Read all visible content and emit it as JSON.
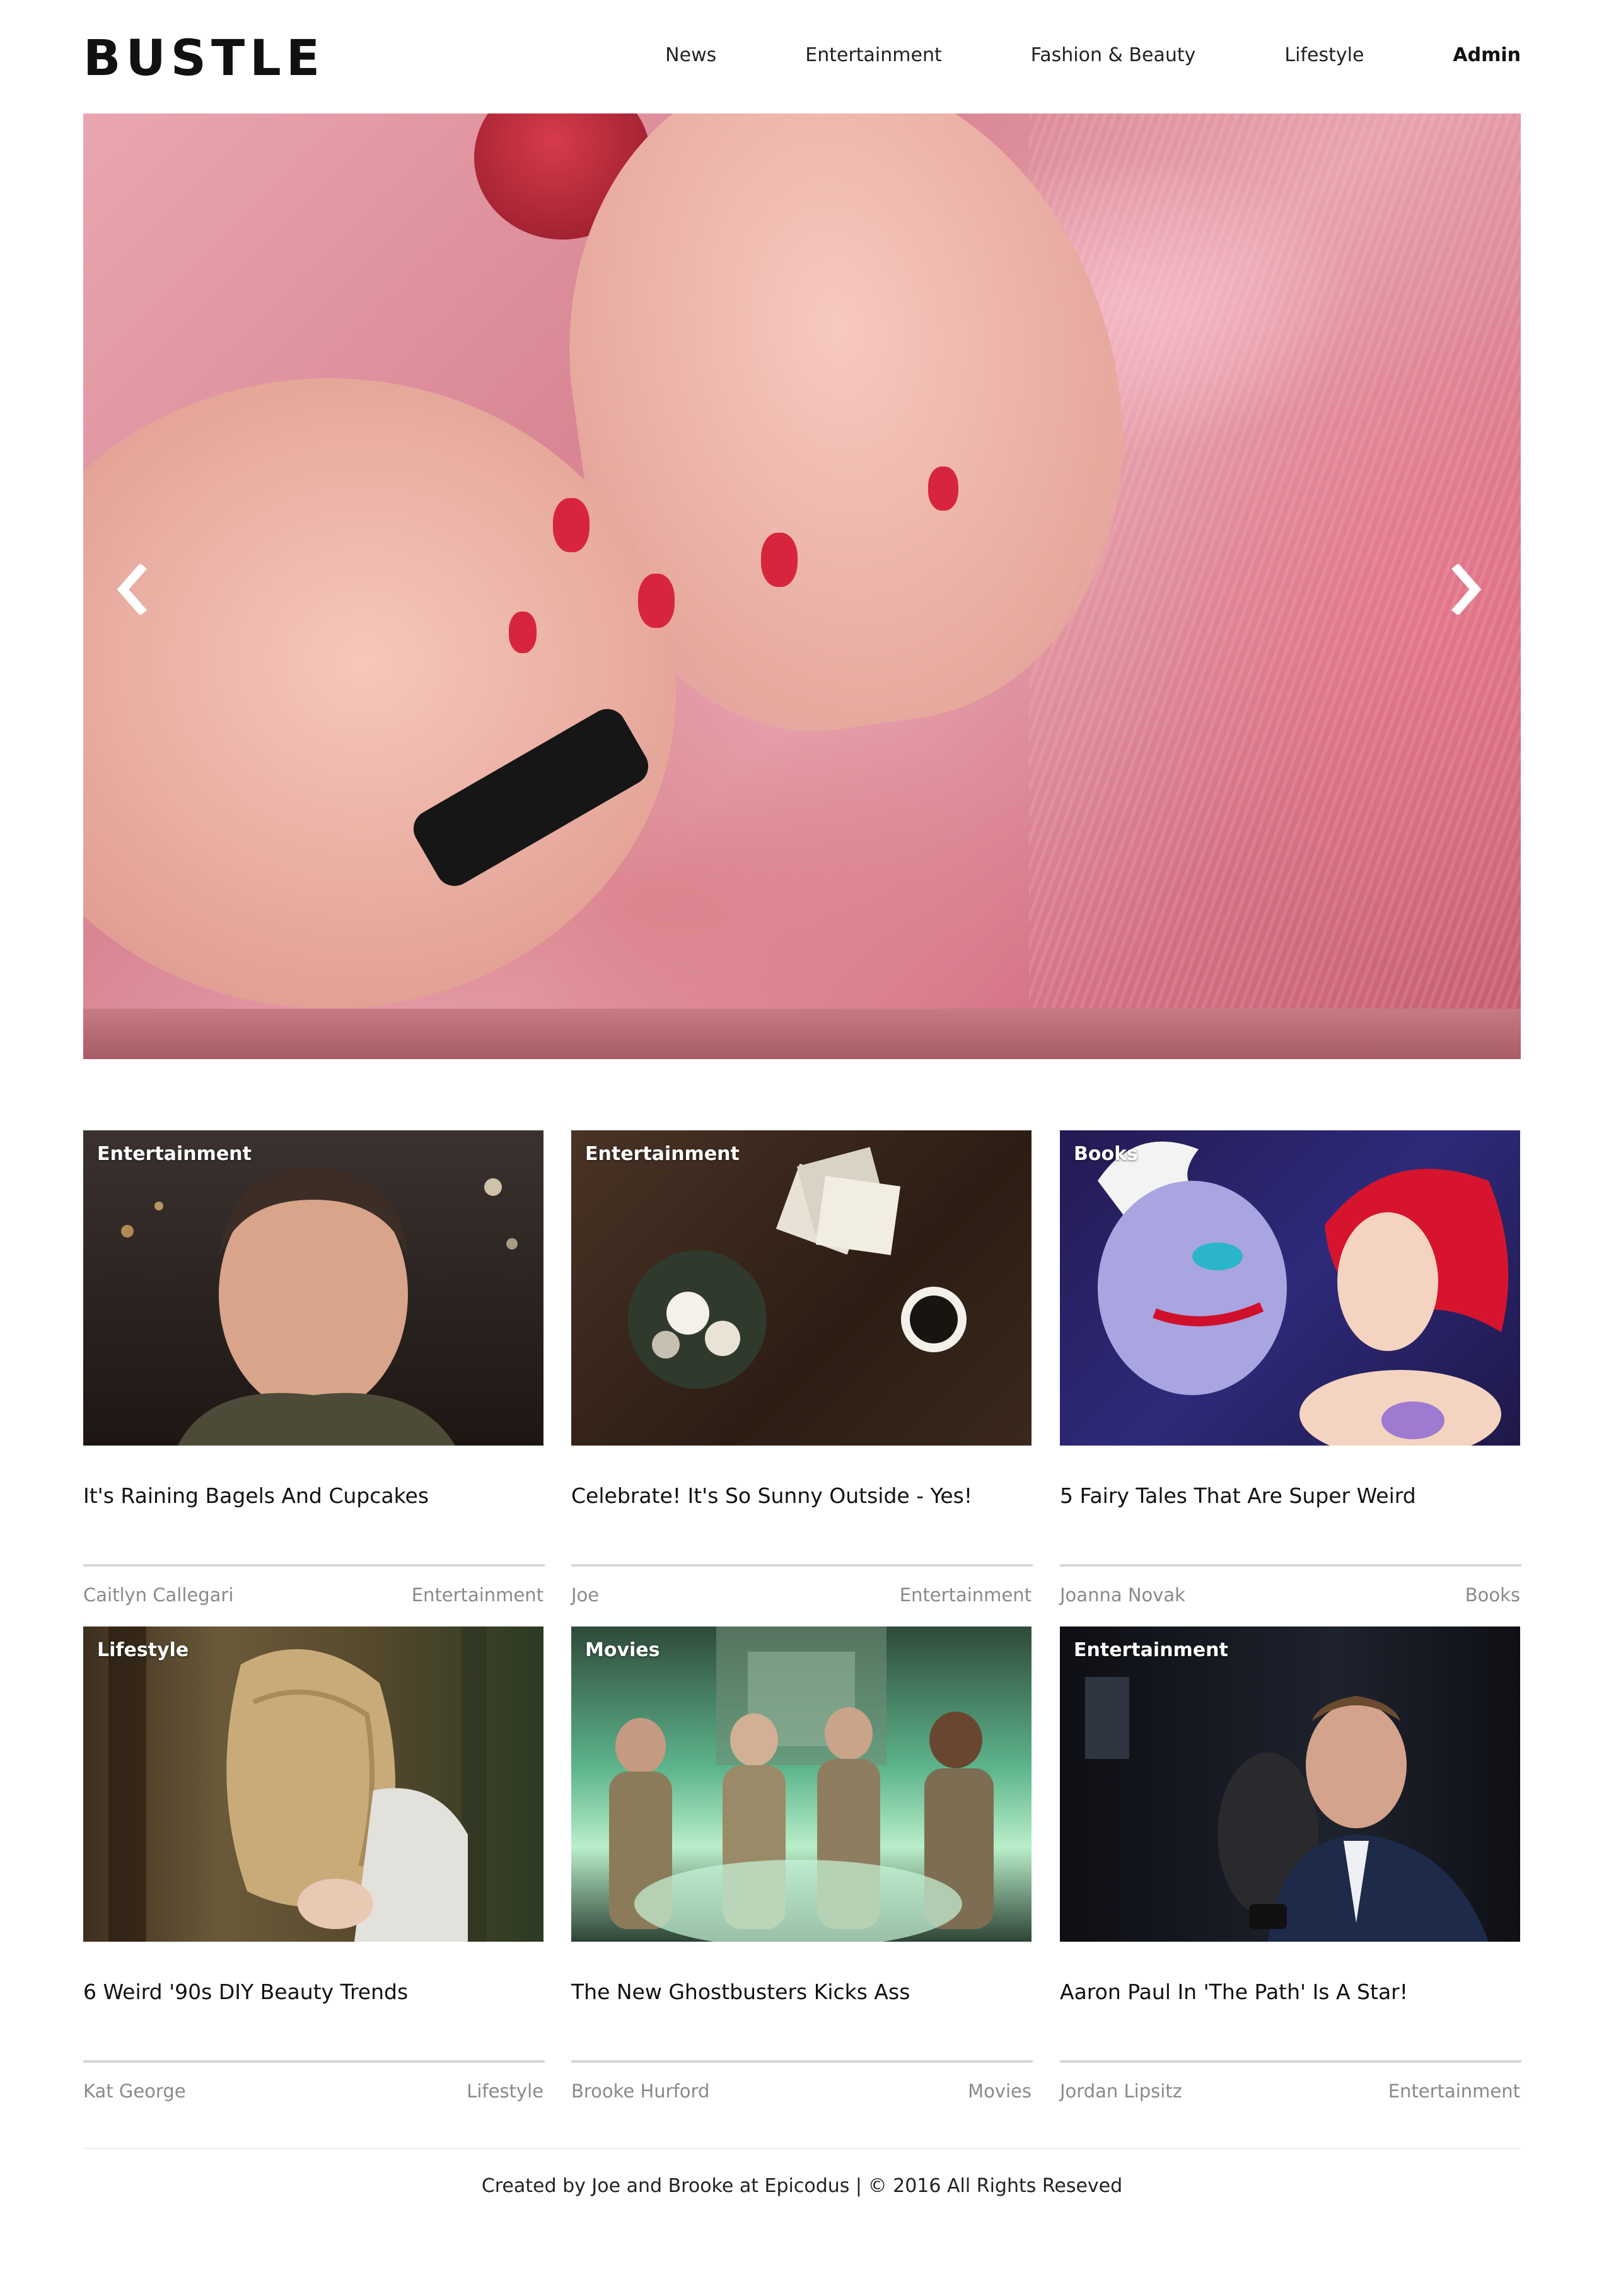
{
  "header": {
    "logo": "BUSTLE",
    "nav": [
      "News",
      "Entertainment",
      "Fashion & Beauty",
      "Lifestyle",
      "Admin"
    ]
  },
  "carousel": {
    "image": "nail-painting-photo",
    "prev_icon": "chevron-left-icon",
    "next_icon": "chevron-right-icon"
  },
  "articles": [
    {
      "badge": "Entertainment",
      "title": "It's Raining Bagels And Cupcakes",
      "author": "Caitlyn Callegari",
      "category": "Entertainment"
    },
    {
      "badge": "Entertainment",
      "title": "Celebrate! It's So Sunny Outside - Yes!",
      "author": "Joe",
      "category": "Entertainment"
    },
    {
      "badge": "Books",
      "title": "5 Fairy Tales That Are Super Weird",
      "author": "Joanna Novak",
      "category": "Books"
    },
    {
      "badge": "Lifestyle",
      "title": "6 Weird '90s DIY Beauty Trends",
      "author": "Kat George",
      "category": "Lifestyle"
    },
    {
      "badge": "Movies",
      "title": "The New Ghostbusters Kicks Ass",
      "author": "Brooke Hurford",
      "category": "Movies"
    },
    {
      "badge": "Entertainment",
      "title": "Aaron Paul In 'The Path' Is A Star!",
      "author": "Jordan Lipsitz",
      "category": "Entertainment"
    }
  ],
  "footer": {
    "text": "Created by Joe and Brooke at Epicodus | © 2016 All Rights Reseved"
  },
  "colors": {
    "text": "#222222",
    "meta": "#8a8a8a",
    "divider": "#d6d6d6"
  }
}
